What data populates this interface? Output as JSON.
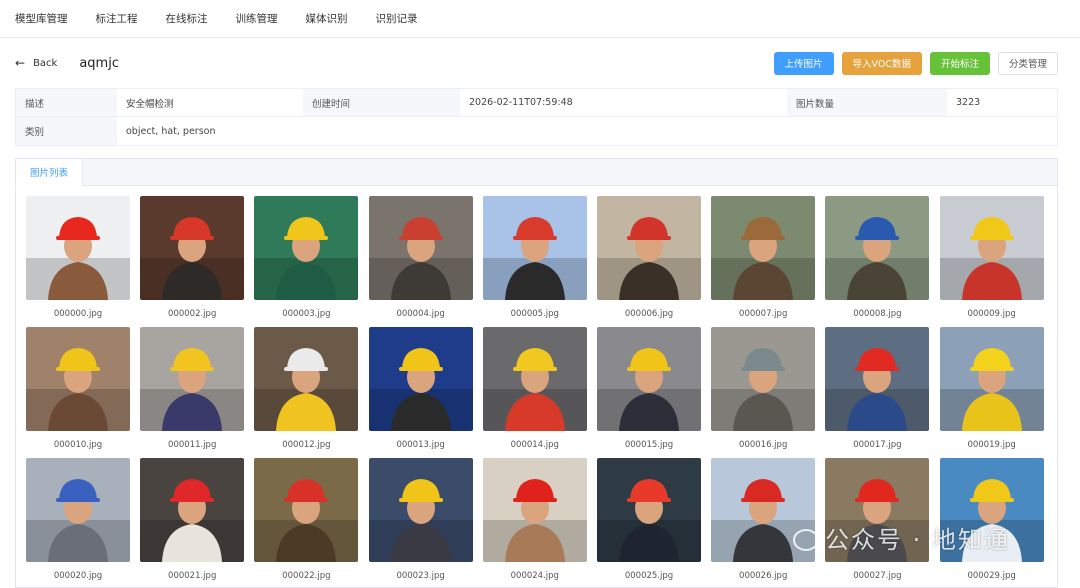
{
  "nav": {
    "items": [
      "模型库管理",
      "标注工程",
      "在线标注",
      "训练管理",
      "媒体识别",
      "识别记录"
    ]
  },
  "header": {
    "back_label": "Back",
    "title": "aqmjc",
    "buttons": {
      "upload": "上传图片",
      "import_voc": "导入VOC数据",
      "start_annotate": "开始标注",
      "category_manage": "分类管理"
    }
  },
  "info": {
    "desc_label": "描述",
    "desc_value": "安全帽检测",
    "created_label": "创建时间",
    "created_value": "2026-02-11T07:59:48",
    "count_label": "图片数量",
    "count_value": "3223",
    "category_label": "类别",
    "category_value": "object, hat, person"
  },
  "tabs": {
    "image_list": "图片列表"
  },
  "colors": {
    "primary": "#409eff",
    "warning": "#e6a23c",
    "success": "#67c23a"
  },
  "images": [
    {
      "name": "000000.jpg",
      "bg": "#eef0f2",
      "hat": "#e8281e",
      "fg": "#8a5a3c"
    },
    {
      "name": "000002.jpg",
      "bg": "#5a3a2c",
      "hat": "#d8382a",
      "fg": "#2e2a28"
    },
    {
      "name": "000003.jpg",
      "bg": "#2f7a58",
      "hat": "#f0c61a",
      "fg": "#1f5c44"
    },
    {
      "name": "000004.jpg",
      "bg": "#7a746c",
      "hat": "#c94030",
      "fg": "#3e3a36"
    },
    {
      "name": "000005.jpg",
      "bg": "#a8c2e8",
      "hat": "#d83a2c",
      "fg": "#2a2a2a"
    },
    {
      "name": "000006.jpg",
      "bg": "#c2b6a2",
      "hat": "#d2332a",
      "fg": "#3a3028"
    },
    {
      "name": "000007.jpg",
      "bg": "#7c8a70",
      "hat": "#9a6a3a",
      "fg": "#5a4632"
    },
    {
      "name": "000008.jpg",
      "bg": "#8c9a84",
      "hat": "#2a5ab0",
      "fg": "#4a4436"
    },
    {
      "name": "000009.jpg",
      "bg": "#c8ccd2",
      "hat": "#f0c818",
      "fg": "#c8342a"
    },
    {
      "name": "000010.jpg",
      "bg": "#a0826a",
      "hat": "#f0c418",
      "fg": "#6a4a34"
    },
    {
      "name": "000011.jpg",
      "bg": "#a8a4a0",
      "hat": "#f2c420",
      "fg": "#3a3a6a"
    },
    {
      "name": "000012.jpg",
      "bg": "#6c5a48",
      "hat": "#eaeaea",
      "fg": "#f0c420"
    },
    {
      "name": "000013.jpg",
      "bg": "#1e3c8a",
      "hat": "#f0c418",
      "fg": "#2a2a2a"
    },
    {
      "name": "000014.jpg",
      "bg": "#6a6a6c",
      "hat": "#f0c820",
      "fg": "#d83a2a"
    },
    {
      "name": "000015.jpg",
      "bg": "#8a8a8e",
      "hat": "#f0c418",
      "fg": "#2c2e3a"
    },
    {
      "name": "000016.jpg",
      "bg": "#9a9890",
      "hat": "#7a8a8c",
      "fg": "#5a5650"
    },
    {
      "name": "000017.jpg",
      "bg": "#5e6e82",
      "hat": "#e02a22",
      "fg": "#2a4a8a"
    },
    {
      "name": "000019.jpg",
      "bg": "#8ca0b8",
      "hat": "#f2d21a",
      "fg": "#e8c41a"
    },
    {
      "name": "000020.jpg",
      "bg": "#a8b0bc",
      "hat": "#3a60c0",
      "fg": "#6a6e78"
    },
    {
      "name": "000021.jpg",
      "bg": "#4a4440",
      "hat": "#e0282a",
      "fg": "#e8e4dc"
    },
    {
      "name": "000022.jpg",
      "bg": "#7a6a48",
      "hat": "#d83228",
      "fg": "#4a3a26"
    },
    {
      "name": "000023.jpg",
      "bg": "#3a4c6a",
      "hat": "#f0c418",
      "fg": "#3a3a44"
    },
    {
      "name": "000024.jpg",
      "bg": "#d8d0c2",
      "hat": "#e0221c",
      "fg": "#a87a58"
    },
    {
      "name": "000025.jpg",
      "bg": "#2e3a44",
      "hat": "#e83a2a",
      "fg": "#1e2430"
    },
    {
      "name": "000026.jpg",
      "bg": "#b8c8da",
      "hat": "#d82a22",
      "fg": "#34363c"
    },
    {
      "name": "000027.jpg",
      "bg": "#8a7a62",
      "hat": "#e0281e",
      "fg": "#4a4a4e"
    },
    {
      "name": "000029.jpg",
      "bg": "#4a8ac2",
      "hat": "#f0c81a",
      "fg": "#e8eef4"
    }
  ],
  "watermark": "公众号 · 地知通"
}
